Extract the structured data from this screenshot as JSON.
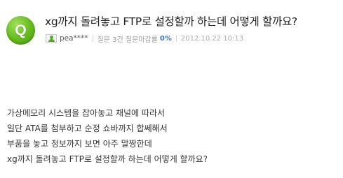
{
  "question": {
    "badge_letter": "Q",
    "title": "xg까지 돌려놓고 FTP로 설정할까 하는데 어떻게 할까요?",
    "author": "pea****",
    "stats_label": "질문 3건 질문마감률",
    "close_rate": "0%",
    "date": "2012.10.22 10:13",
    "body_lines": [
      "가상메모리 시스템을 잡아놓고 채널에 따라서",
      "일단 ATA를 첨부하고 순정 쇼바까지 합쎄해서",
      "부품을 놓고 정보까지 보면 아주 말짱한데",
      "xg까지 돌려놓고 FTP로 설정할까 하는데 어떻게 할까요?"
    ]
  },
  "colors": {
    "badge_green": "#63b91a",
    "rate_blue": "#3b74c8"
  }
}
